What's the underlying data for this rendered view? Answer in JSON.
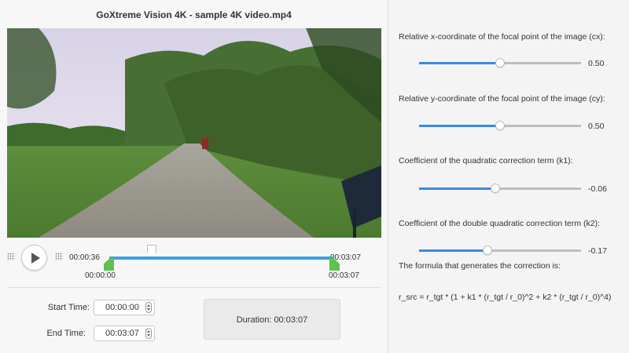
{
  "window_title": "GoXtreme Vision 4K - sample 4K video.mp4",
  "player": {
    "current_time": "00:00:36",
    "total_time": "00:03:07",
    "trim_start": "00:00:00",
    "trim_end": "00:03:07",
    "playhead_fraction": 0.19,
    "trim_start_fraction": 0.0,
    "trim_end_fraction": 1.0
  },
  "trim": {
    "start_label": "Start Time:",
    "start_value": "00:00:00",
    "end_label": "End Time:",
    "end_value": "00:03:07",
    "duration_label": "Duration:",
    "duration_value": "00:03:07"
  },
  "params": [
    {
      "label": "Relative x-coordinate of the focal point of the image (cx):",
      "value_text": "0.50",
      "fraction": 0.5
    },
    {
      "label": "Relative y-coordinate of the focal point of the image (cy):",
      "value_text": "0.50",
      "fraction": 0.5
    },
    {
      "label": "Coefficient of the quadratic correction term (k1):",
      "value_text": "-0.06",
      "fraction": 0.47
    },
    {
      "label": "Coefficient of the double quadratic correction term (k2):",
      "value_text": "-0.17",
      "fraction": 0.42
    }
  ],
  "formula": {
    "heading": "The formula that generates the correction is:",
    "text": "r_src = r_tgt * (1 + k1 * (r_tgt / r_0)^2 + k2 * (r_tgt / r_0)^4)"
  },
  "colors": {
    "accent": "#3a8ae0",
    "timeline": "#3aa0e0",
    "trim_handle": "#5ec24e"
  },
  "icons": [
    "play-icon",
    "grip-icon",
    "spinner-icon"
  ]
}
